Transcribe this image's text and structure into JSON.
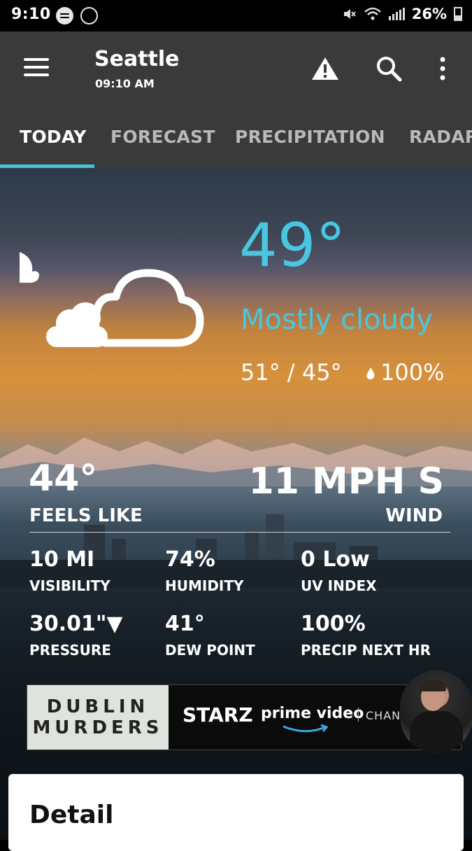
{
  "status_bar": {
    "time": "9:10",
    "battery": "26%",
    "icons": [
      "spotify-icon",
      "messenger-icon",
      "mute-icon",
      "wifi-icon",
      "signal-icon",
      "battery-icon"
    ]
  },
  "app_bar": {
    "city": "Seattle",
    "time": "09:10 AM",
    "icons": [
      "menu-icon",
      "alert-icon",
      "search-icon",
      "more-icon"
    ]
  },
  "tabs": [
    {
      "label": "TODAY",
      "active": true
    },
    {
      "label": "FORECAST",
      "active": false
    },
    {
      "label": "PRECIPITATION",
      "active": false
    },
    {
      "label": "RADAR",
      "active": false
    }
  ],
  "current": {
    "temperature": "49°",
    "condition": "Mostly cloudy",
    "hi_lo": "51° / 45°",
    "precip_chance": "100%"
  },
  "feels_like": {
    "value": "44°",
    "label": "FEELS LIKE"
  },
  "wind": {
    "value": "11 MPH S",
    "label": "WIND"
  },
  "stats": [
    {
      "value": "10 MI",
      "label": "VISIBILITY"
    },
    {
      "value": "74%",
      "label": "HUMIDITY"
    },
    {
      "value": "0 Low",
      "label": "UV INDEX"
    },
    {
      "value": "30.01\"▼",
      "label": "PRESSURE"
    },
    {
      "value": "41°",
      "label": "DEW POINT"
    },
    {
      "value": "100%",
      "label": "PRECIP NEXT HR"
    }
  ],
  "ad": {
    "title_line1": "DUBLIN",
    "title_line2": "MURDERS",
    "brand": "STARZ",
    "partner": "prime video",
    "suffix": "CHAN"
  },
  "detail": {
    "title": "Detail"
  },
  "colors": {
    "accent": "#49c6e0",
    "app_bar": "#3a3a3a",
    "tab_indicator": "#44c2dc"
  }
}
